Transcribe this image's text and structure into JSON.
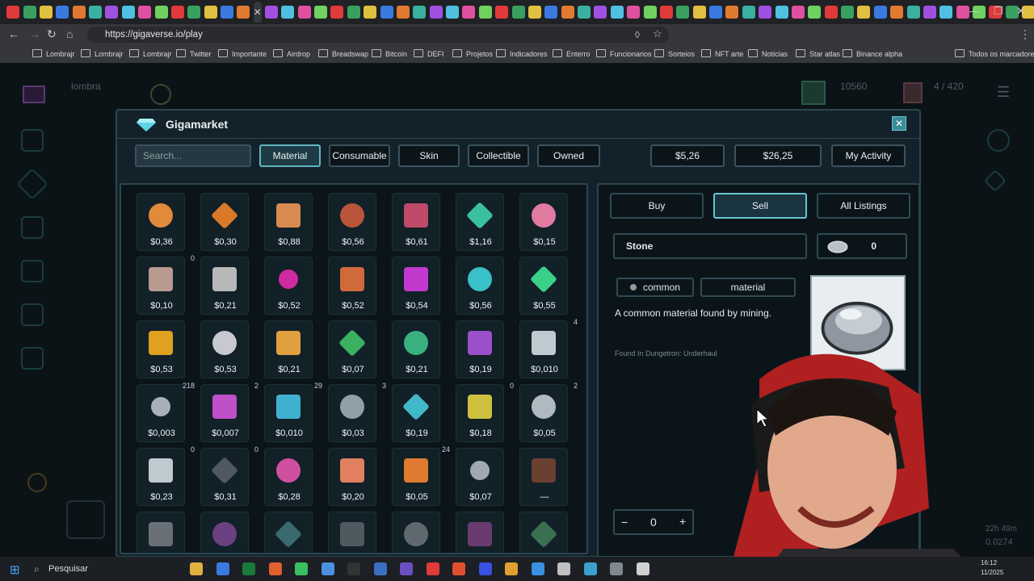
{
  "browser": {
    "url": "https://gigaverse.io/play",
    "bookmarks": [
      "Lombrajr",
      "Lombrajr",
      "Lombrajr",
      "Twitter",
      "Importante",
      "Airdrop",
      "Breadswap",
      "Bitcoin",
      "DEFI",
      "Projetos",
      "Indicadores",
      "Enterro",
      "Funcionarios",
      "Sorteios",
      "NFT arte",
      "Noticias",
      "Star atlas",
      "Binance alpha"
    ],
    "all_bookmarks": "Todos os marcadores",
    "active_tab_icon": "close-icon"
  },
  "game_header": {
    "player_name": "lombra",
    "currency": "10560",
    "capacity": "4 / 420"
  },
  "market": {
    "title": "Gigamarket",
    "search_placeholder": "Search...",
    "filters": [
      "Material",
      "Consumable",
      "Skin",
      "Collectible",
      "Owned"
    ],
    "balance_1": "$5,26",
    "balance_2": "$26,25",
    "my_activity": "My Activity"
  },
  "items": [
    {
      "price": "$0,36",
      "color": "#e08a3a",
      "count": ""
    },
    {
      "price": "$0,30",
      "color": "#d97a2a",
      "count": ""
    },
    {
      "price": "$0,88",
      "color": "#d98a50",
      "count": ""
    },
    {
      "price": "$0,56",
      "color": "#b8553a",
      "count": ""
    },
    {
      "price": "$0,61",
      "color": "#c04a6a",
      "count": ""
    },
    {
      "price": "$1,16",
      "color": "#3ac0a0",
      "count": ""
    },
    {
      "price": "$0,15",
      "color": "#e07aa0",
      "count": ""
    },
    {
      "price": "$0,10",
      "color": "#b89a90",
      "count": "0"
    },
    {
      "price": "$0,21",
      "color": "#b8b8b8",
      "count": ""
    },
    {
      "price": "$0,52",
      "color": "#d02aa0",
      "count": ""
    },
    {
      "price": "$0,52",
      "color": "#d06a3a",
      "count": ""
    },
    {
      "price": "$0,54",
      "color": "#c03ad0",
      "count": ""
    },
    {
      "price": "$0,56",
      "color": "#3ac0c8",
      "count": ""
    },
    {
      "price": "$0,55",
      "color": "#3ad08a",
      "count": ""
    },
    {
      "price": "$0,53",
      "color": "#e0a020",
      "count": ""
    },
    {
      "price": "$0,53",
      "color": "#c8c8d0",
      "count": ""
    },
    {
      "price": "$0,21",
      "color": "#e0a040",
      "count": ""
    },
    {
      "price": "$0,07",
      "color": "#3ab060",
      "count": ""
    },
    {
      "price": "$0,21",
      "color": "#3ab080",
      "count": ""
    },
    {
      "price": "$0,19",
      "color": "#9a50c8",
      "count": ""
    },
    {
      "price": "$0,010",
      "color": "#c0c8d0",
      "count": "4"
    },
    {
      "price": "$0,003",
      "color": "#a8b0b8",
      "count": "218"
    },
    {
      "price": "$0,007",
      "color": "#c050c8",
      "count": "2"
    },
    {
      "price": "$0,010",
      "color": "#40b0d0",
      "count": "29"
    },
    {
      "price": "$0,03",
      "color": "#90a0a8",
      "count": "3"
    },
    {
      "price": "$0,19",
      "color": "#40b8c8",
      "count": ""
    },
    {
      "price": "$0,18",
      "color": "#d0c040",
      "count": "0"
    },
    {
      "price": "$0,05",
      "color": "#b0b8c0",
      "count": "2"
    },
    {
      "price": "$0,23",
      "color": "#c0c8d0",
      "count": "0"
    },
    {
      "price": "$0,31",
      "color": "#505860",
      "count": "0"
    },
    {
      "price": "$0,28",
      "color": "#d050a0",
      "count": ""
    },
    {
      "price": "$0,20",
      "color": "#e08060",
      "count": ""
    },
    {
      "price": "$0,05",
      "color": "#e07a30",
      "count": "24"
    },
    {
      "price": "$0,07",
      "color": "#a0a8b0",
      "count": ""
    },
    {
      "price": "—",
      "color": "#6a4030",
      "count": ""
    },
    {
      "price": "",
      "color": "#6a7078",
      "count": ""
    },
    {
      "price": "",
      "color": "#6a4080",
      "count": ""
    },
    {
      "price": "",
      "color": "#3a6a70",
      "count": ""
    },
    {
      "price": "",
      "color": "#505860",
      "count": ""
    },
    {
      "price": "",
      "color": "#606870",
      "count": ""
    },
    {
      "price": "",
      "color": "#6a3a70",
      "count": ""
    },
    {
      "price": "",
      "color": "#3a7050",
      "count": ""
    }
  ],
  "detail": {
    "tabs": [
      "Buy",
      "Sell",
      "All Listings"
    ],
    "item_name": "Stone",
    "owned_qty": "0",
    "rarity": "common",
    "category": "material",
    "description": "A common material found by mining.",
    "found_in": "Found In Dungetron: Underhaul",
    "quantity": "0",
    "minus": "−",
    "plus": "+"
  },
  "taskbar": {
    "search": "Pesquisar",
    "time": "16:12",
    "date": "11/2025"
  },
  "footer_right": {
    "timer": "22h 49m",
    "value": "0.0274"
  }
}
